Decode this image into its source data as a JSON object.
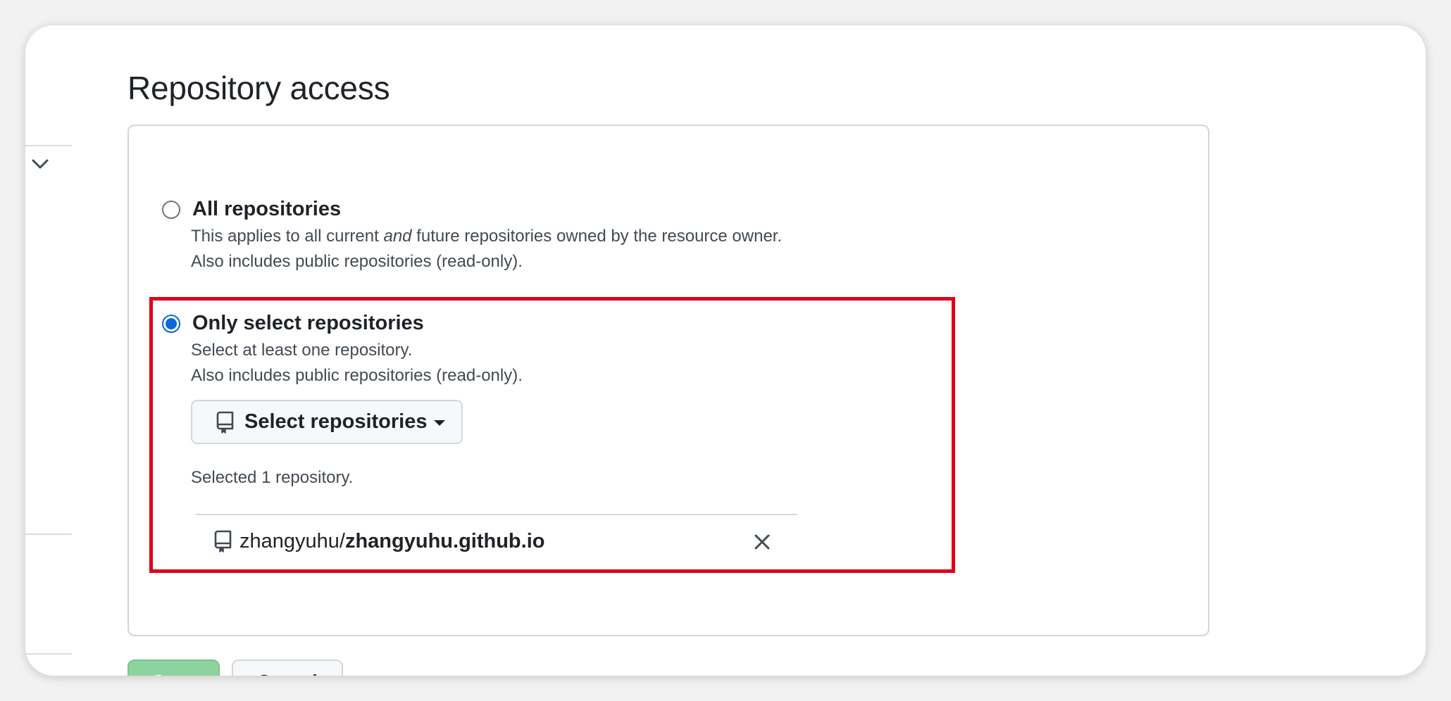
{
  "section": {
    "title": "Repository access"
  },
  "options": {
    "all": {
      "label": "All repositories",
      "desc_before": "This applies to all current ",
      "desc_em": "and",
      "desc_after": " future repositories owned by the resource owner.",
      "desc_line2": "Also includes public repositories (read-only).",
      "checked": false
    },
    "select": {
      "label": "Only select repositories",
      "desc_line1": "Select at least one repository.",
      "desc_line2": "Also includes public repositories (read-only).",
      "checked": true
    }
  },
  "select_button": {
    "label": "Select repositories",
    "icon": "repo-icon",
    "caret_icon": "triangle-down-icon"
  },
  "selected_summary": "Selected 1 repository.",
  "selected_repos": [
    {
      "owner": "zhangyuhu/",
      "name": "zhangyuhu.github.io",
      "icon": "repo-icon",
      "remove_icon": "x-icon"
    }
  ],
  "footer": {
    "save_label": "Save",
    "cancel_label": "Cancel"
  },
  "colors": {
    "accent": "#0969da",
    "highlight": "#e0001b",
    "save_button": "#8dd39e"
  }
}
